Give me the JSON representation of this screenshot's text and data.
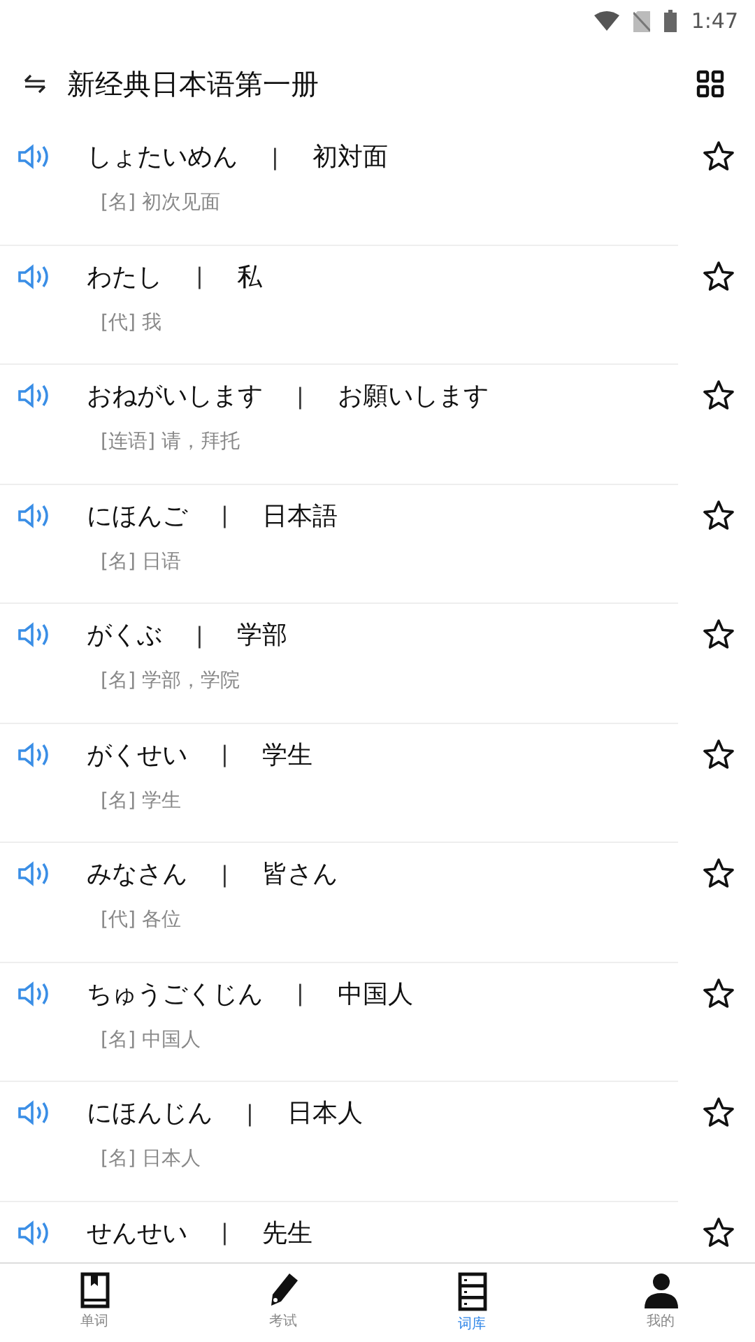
{
  "status_bar": {
    "time": "1:47"
  },
  "header": {
    "title": "新经典日本语第一册"
  },
  "words": [
    {
      "kana": "しょたいめん",
      "kanji": "初対面",
      "meaning": "[名]  初次见面",
      "starred": false
    },
    {
      "kana": "わたし",
      "kanji": "私",
      "meaning": "[代]  我",
      "starred": false
    },
    {
      "kana": "おねがいします",
      "kanji": "お願いします",
      "meaning": "[连语]  请，拜托",
      "starred": false
    },
    {
      "kana": "にほんご",
      "kanji": "日本語",
      "meaning": "[名]  日语",
      "starred": false
    },
    {
      "kana": "がくぶ",
      "kanji": "学部",
      "meaning": "[名]  学部，学院",
      "starred": false
    },
    {
      "kana": "がくせい",
      "kanji": "学生",
      "meaning": "[名]  学生",
      "starred": false
    },
    {
      "kana": "みなさん",
      "kanji": "皆さん",
      "meaning": "[代]  各位",
      "starred": false
    },
    {
      "kana": "ちゅうごくじん",
      "kanji": "中国人",
      "meaning": "[名]  中国人",
      "starred": false
    },
    {
      "kana": "にほんじん",
      "kanji": "日本人",
      "meaning": "[名]  日本人",
      "starred": false
    },
    {
      "kana": "せんせい",
      "kanji": "先生",
      "starred": false
    }
  ],
  "separator": "|",
  "nav": [
    {
      "label": "单词",
      "kind": "book",
      "selected": false
    },
    {
      "label": "考试",
      "kind": "pencil",
      "selected": false
    },
    {
      "label": "词库",
      "kind": "cabinet",
      "selected": true
    },
    {
      "label": "我的",
      "kind": "person",
      "selected": false
    }
  ]
}
